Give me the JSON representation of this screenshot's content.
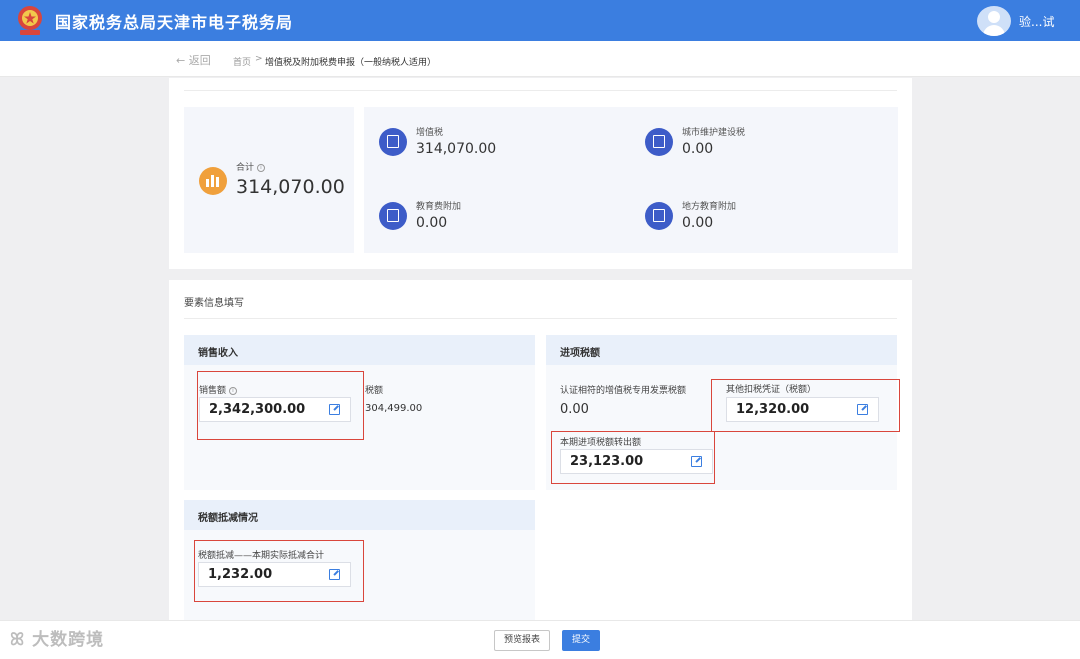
{
  "header": {
    "site_title": "国家税务总局天津市电子税务局",
    "username": "验...试"
  },
  "breadcrumb": {
    "back_label": "返回",
    "home": "首页",
    "separator": ">",
    "current": "增值税及附加税费申报（一般纳税人适用）"
  },
  "summary": {
    "total_label": "合计",
    "total_value": "314,070.00",
    "items": [
      {
        "label": "增值税",
        "value": "314,070.00",
        "icon": "vat-icon"
      },
      {
        "label": "城市维护建设税",
        "value": "0.00",
        "icon": "building-icon"
      },
      {
        "label": "教育费附加",
        "value": "0.00",
        "icon": "graduation-cap-icon"
      },
      {
        "label": "地方教育附加",
        "value": "0.00",
        "icon": "book-icon"
      }
    ]
  },
  "form": {
    "section_title": "要素信息填写",
    "sales": {
      "title": "销售收入",
      "sales_amount_label": "销售额",
      "sales_amount_value": "2,342,300.00",
      "tax_label_partial": "税额",
      "tax_value_partial": "304,499.00"
    },
    "input_tax": {
      "title": "进项税额",
      "certified_label": "认证相符的增值税专用发票税额",
      "certified_value": "0.00",
      "other_label": "其他扣税凭证（税额）",
      "other_value": "12,320.00",
      "transfer_label": "本期进项税额转出额",
      "transfer_value": "23,123.00"
    },
    "deduction": {
      "title": "税额抵减情况",
      "label": "税额抵减——本期实际抵减合计",
      "value": "1,232.00"
    }
  },
  "footer": {
    "preview_label": "预览报表",
    "submit_label": "提交"
  },
  "watermark": {
    "text": "大数跨境"
  },
  "colors": {
    "brand": "#3b7ee0",
    "highlight": "#d9463c",
    "total_icon": "#f0a03c",
    "tax_icon": "#3d5cc8"
  }
}
